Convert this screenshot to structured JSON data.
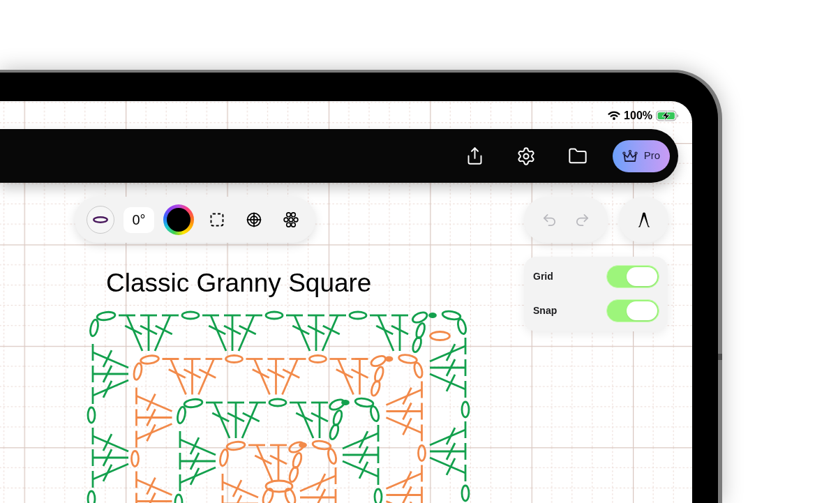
{
  "status_bar": {
    "battery": "100%",
    "charging": true
  },
  "top_bar": {
    "pro_button": "Pro"
  },
  "tool_bar": {
    "rotation": "0°",
    "color": "#000000"
  },
  "history": {
    "undo": {
      "disabled": true
    },
    "redo": {
      "disabled": true
    }
  },
  "settings": [
    {
      "label": "Grid",
      "on": true
    },
    {
      "label": "Snap",
      "on": true
    }
  ],
  "pattern": {
    "title": "Classic Granny Square"
  }
}
